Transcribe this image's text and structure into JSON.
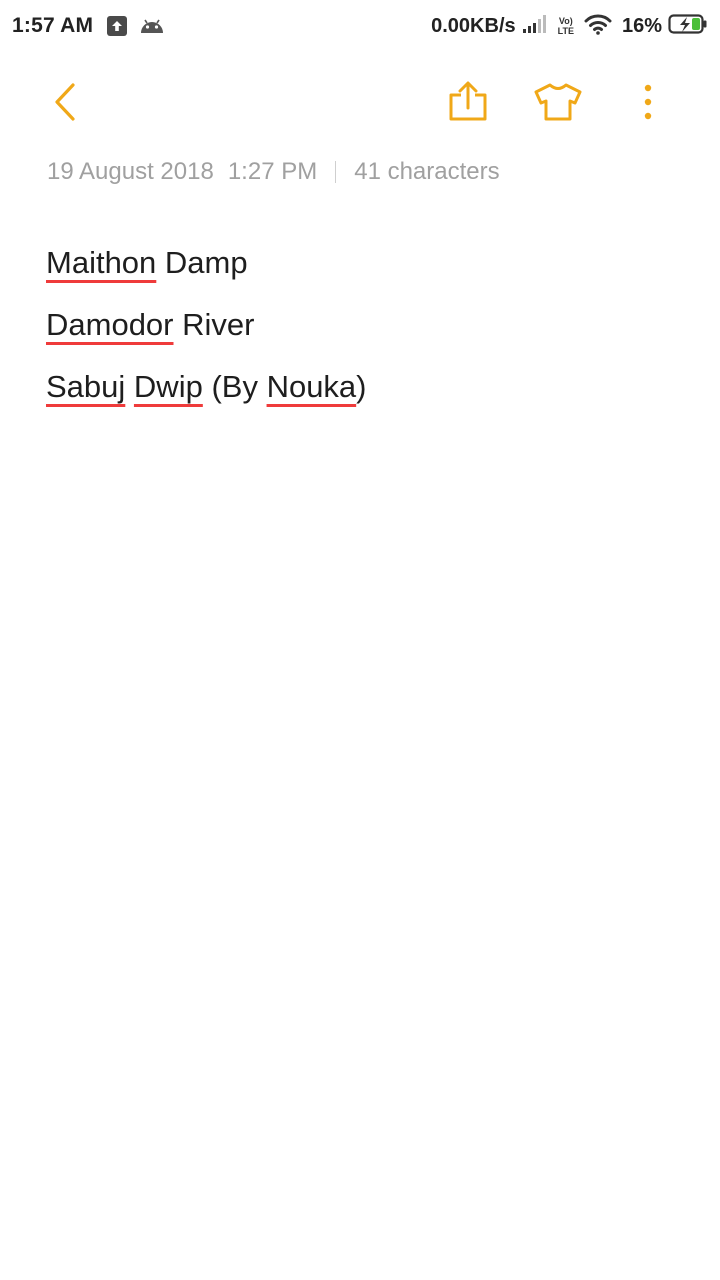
{
  "status_bar": {
    "time": "1:57 AM",
    "network_speed": "0.00KB/s",
    "volte_top": "Vo)",
    "volte_bottom": "LTE",
    "battery_percent": "16%",
    "icons": [
      "upload-icon",
      "android-icon",
      "signal-icon",
      "volte-icon",
      "wifi-icon",
      "battery-charging-icon"
    ]
  },
  "toolbar": {
    "accent_color": "#f0a818",
    "icons": [
      "back-icon",
      "share-icon",
      "theme-icon",
      "more-icon"
    ]
  },
  "meta": {
    "date": "19 August 2018",
    "time": "1:27 PM",
    "characters": "41 characters"
  },
  "note": {
    "lines": [
      [
        {
          "text": "Maithon",
          "spell": true
        },
        {
          "text": " Damp",
          "spell": false
        }
      ],
      [
        {
          "text": "Damodor",
          "spell": true
        },
        {
          "text": " River",
          "spell": false
        }
      ],
      [
        {
          "text": "Sabuj",
          "spell": true
        },
        {
          "text": " ",
          "spell": false
        },
        {
          "text": "Dwip",
          "spell": true
        },
        {
          "text": " (By ",
          "spell": false
        },
        {
          "text": "Nouka",
          "spell": true
        },
        {
          "text": ")",
          "spell": false
        }
      ]
    ],
    "spellcheck_color": "#ef3b3b"
  }
}
